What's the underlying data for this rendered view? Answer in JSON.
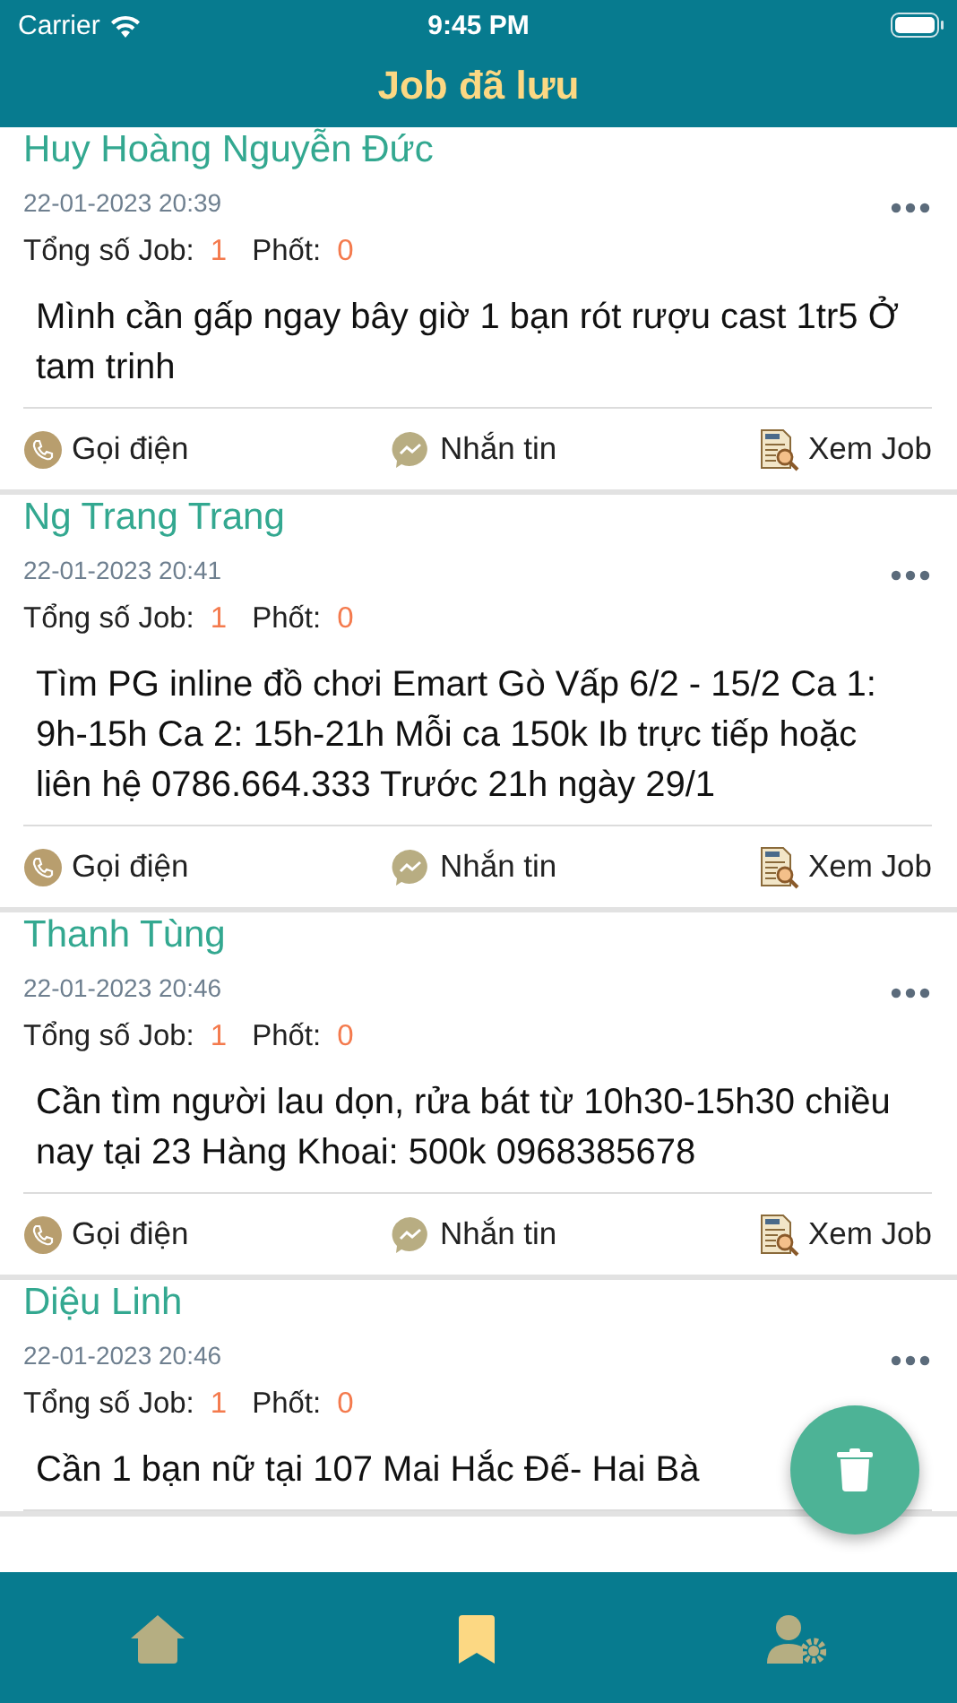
{
  "status_bar": {
    "carrier": "Carrier",
    "time": "9:45 PM"
  },
  "title": "Job đã lưu",
  "jobs": [
    {
      "name": "Huy Hoàng Nguyễn Đức",
      "date": "22-01-2023 20:39",
      "total_label": "Tổng số Job:",
      "total": "1",
      "scam_label": "Phốt:",
      "scam": "0",
      "description": "Mình cần gấp ngay bây giờ 1 bạn rót rượu cast 1tr5 Ở tam trinh",
      "actions": [
        "Gọi điện",
        "Nhắn tin",
        "Xem Job"
      ]
    },
    {
      "name": "Ng Trang Trang",
      "date": "22-01-2023 20:41",
      "total_label": "Tổng số Job:",
      "total": "1",
      "scam_label": "Phốt:",
      "scam": "0",
      "description": "Tìm PG inline đồ chơi Emart Gò Vấp 6/2 - 15/2 Ca 1: 9h-15h Ca 2: 15h-21h Mỗi ca 150k Ib trực tiếp hoặc liên hệ 0786.664.333 Trước 21h ngày 29/1",
      "actions": [
        "Gọi điện",
        "Nhắn tin",
        "Xem Job"
      ]
    },
    {
      "name": "Thanh Tùng",
      "date": "22-01-2023 20:46",
      "total_label": "Tổng số Job:",
      "total": "1",
      "scam_label": "Phốt:",
      "scam": "0",
      "description": "Cần tìm người lau dọn, rửa bát từ 10h30-15h30 chiều nay tại 23 Hàng Khoai: 500k 0968385678",
      "actions": [
        "Gọi điện",
        "Nhắn tin",
        "Xem Job"
      ]
    },
    {
      "name": "Diệu Linh",
      "date": "22-01-2023 20:46",
      "total_label": "Tổng số Job:",
      "total": "1",
      "scam_label": "Phốt:",
      "scam": "0",
      "description": "Cần 1 bạn nữ tại 107 Mai Hắc Đế- Hai Bà"
    }
  ],
  "tabs": [
    {
      "kind": "home",
      "selected": false
    },
    {
      "kind": "saved",
      "selected": true
    },
    {
      "kind": "account",
      "selected": false
    }
  ]
}
